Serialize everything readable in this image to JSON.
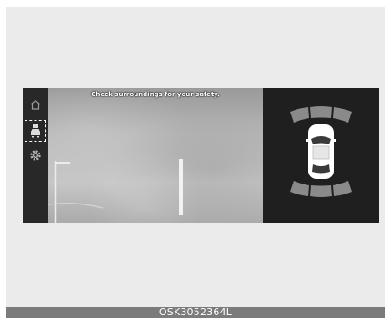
{
  "screen": {
    "warning_message": "Check surroundings for your safety.",
    "rail": {
      "home_icon": "home-icon",
      "camera_icon": "parking-camera-icon",
      "settings_icon": "gear-icon",
      "selected_highlight": "dashed-outline"
    },
    "sensor_panel": {
      "vehicle_icon": "car-top-view-icon",
      "front_sensors": 3,
      "rear_sensors": 3,
      "zone_color": "#8a8a8a"
    }
  },
  "caption": "OSK3052364L"
}
